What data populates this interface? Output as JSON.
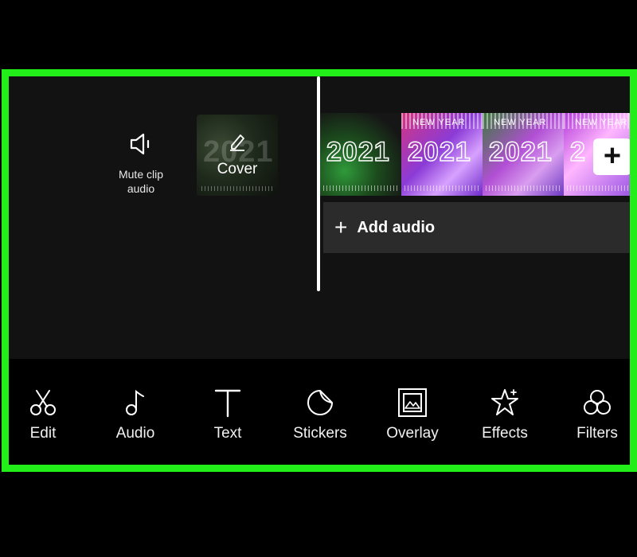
{
  "colors": {
    "frame_highlight": "#22ee1a",
    "background": "#121212",
    "toolbar_bg": "#000000",
    "add_audio_bg": "#2b2b2b"
  },
  "timeline": {
    "mute": {
      "icon": "speaker-icon",
      "label": "Mute clip\naudio"
    },
    "cover": {
      "icon": "pencil-icon",
      "label": "Cover",
      "thumb_text": "2021"
    },
    "clips": [
      {
        "year": "2021",
        "caption": ""
      },
      {
        "year": "2021",
        "caption": "NEW YEAR"
      },
      {
        "year": "2021",
        "caption": "NEW YEAR"
      },
      {
        "year": "2",
        "caption": "NEW YEAR"
      }
    ],
    "add_clip": {
      "icon": "plus-icon",
      "label": "+"
    },
    "add_audio": {
      "icon": "plus-icon",
      "plus": "+",
      "label": "Add audio"
    }
  },
  "toolbar": {
    "items": [
      {
        "label": "Edit",
        "icon": "scissors-icon"
      },
      {
        "label": "Audio",
        "icon": "music-note-icon"
      },
      {
        "label": "Text",
        "icon": "text-icon"
      },
      {
        "label": "Stickers",
        "icon": "sticker-icon"
      },
      {
        "label": "Overlay",
        "icon": "overlay-icon"
      },
      {
        "label": "Effects",
        "icon": "effects-star-icon"
      },
      {
        "label": "Filters",
        "icon": "filters-icon"
      }
    ]
  }
}
